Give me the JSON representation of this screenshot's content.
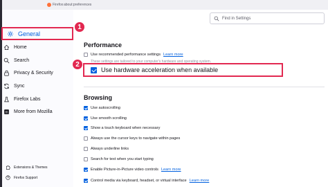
{
  "window": {
    "browser": "Firefox",
    "url": "about:preferences"
  },
  "sidebar": {
    "items": [
      {
        "label": "General",
        "icon": "gear-icon",
        "selected": true
      },
      {
        "label": "Home",
        "icon": "home-icon"
      },
      {
        "label": "Search",
        "icon": "search-icon"
      },
      {
        "label": "Privacy & Security",
        "icon": "lock-icon"
      },
      {
        "label": "Sync",
        "icon": "sync-icon"
      },
      {
        "label": "Firefox Labs",
        "icon": "flask-icon"
      },
      {
        "label": "More from Mozilla",
        "icon": "mozilla-icon"
      }
    ],
    "footer": [
      {
        "label": "Extensions & Themes",
        "icon": "puzzle-icon"
      },
      {
        "label": "Firefox Support",
        "icon": "help-icon"
      }
    ]
  },
  "search": {
    "placeholder": "Find in Settings"
  },
  "annotations": {
    "badge1": "1",
    "badge2": "2",
    "color": "#e22850"
  },
  "performance": {
    "heading": "Performance",
    "recommended_label": "Use recommended performance settings",
    "learn_more": "Learn more",
    "note": "These settings are tailored to your computer's hardware and operating system.",
    "hw_accel_label": "Use hardware acceleration when available"
  },
  "browsing": {
    "heading": "Browsing",
    "options": [
      {
        "label": "Use autoscrolling",
        "checked": true
      },
      {
        "label": "Use smooth scrolling",
        "checked": true
      },
      {
        "label": "Show a touch keyboard when necessary",
        "checked": true
      },
      {
        "label": "Always use the cursor keys to navigate within pages",
        "checked": false
      },
      {
        "label": "Always underline links",
        "checked": false
      },
      {
        "label": "Search for text when you start typing",
        "checked": false
      },
      {
        "label": "Enable Picture-in-Picture video controls",
        "checked": true,
        "learn_more": "Learn more"
      },
      {
        "label": "Control media via keyboard, headset, or virtual interface",
        "checked": true,
        "learn_more": "Learn more"
      }
    ]
  },
  "colors": {
    "accent": "#0060df",
    "checkbox_on": "#0060df",
    "sidebar_bg": "#fbfbfe"
  }
}
